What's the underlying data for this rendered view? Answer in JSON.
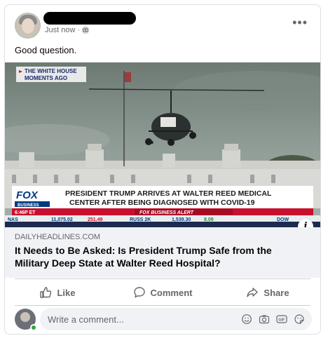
{
  "post": {
    "timestamp": "Just now",
    "separator": " · ",
    "audience_icon": "globe-icon",
    "more_icon": "more-horizontal-icon",
    "more_label": "•••",
    "text": "Good question."
  },
  "media": {
    "corner_tag": "THE WHITE HOUSE MOMENTS AGO",
    "corner_tag_line1": "THE WHITE HOUSE",
    "corner_tag_line2": "MOMENTS AGO",
    "network_logo_line1": "FOX",
    "network_logo_line2": "BUSINESS",
    "time": "6:46P ET",
    "headline_line1": "PRESIDENT TRUMP ARRIVES AT WALTER REED MEDICAL",
    "headline_line2": "CENTER AFTER BEING DIAGNOSED WITH COVID-19",
    "banner": "FOX BUSINESS ALERT",
    "ticker": [
      {
        "symbol": "NAS",
        "value": "11,075.02",
        "change": "251.49"
      },
      {
        "symbol": "RUSS 2K",
        "value": "1,539.30",
        "change": "8.09"
      },
      {
        "symbol": "DOW",
        "value": "",
        "change": ""
      }
    ],
    "info_label": "i"
  },
  "link": {
    "domain": "DAILYHEADLINES.COM",
    "title": "It Needs to Be Asked: Is President Trump Safe from the Military Deep State at Walter Reed Hospital?"
  },
  "actions": {
    "like": "Like",
    "comment": "Comment",
    "share": "Share"
  },
  "comment_box": {
    "placeholder": "Write a comment...",
    "icons": [
      "emoji-icon",
      "camera-icon",
      "gif-icon",
      "sticker-icon"
    ]
  },
  "colors": {
    "fox_red": "#c8102e",
    "fox_blue": "#003a80",
    "online": "#31a24c"
  }
}
